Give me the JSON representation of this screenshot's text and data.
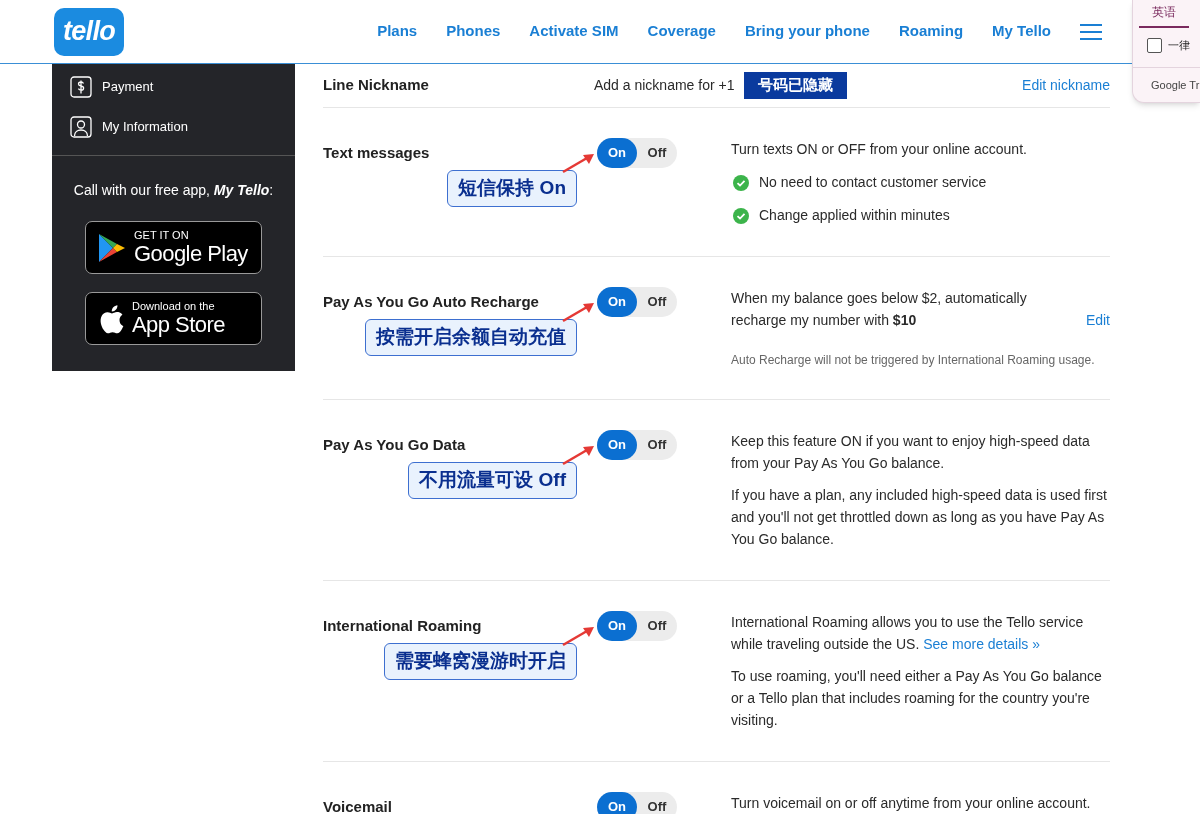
{
  "header": {
    "logo": "tello",
    "nav": [
      "Plans",
      "Phones",
      "Activate SIM",
      "Coverage",
      "Bring your phone",
      "Roaming",
      "My Tello"
    ]
  },
  "translate_popup": {
    "tab": "英语",
    "checkbox": {
      "label": "一律",
      "checked": false
    },
    "footer": "Google Tr"
  },
  "sidebar": {
    "items": [
      {
        "kind": "payment",
        "label": "Payment"
      },
      {
        "kind": "person",
        "label": "My Information"
      }
    ],
    "app_promo": "Call with our free app, **My Tello**:",
    "store_badges": [
      {
        "kind": "google",
        "small": "GET IT ON",
        "big": "Google Play"
      },
      {
        "kind": "apple",
        "small": "Download on the",
        "big": "App Store"
      }
    ]
  },
  "nickname_row": {
    "title": "Line Nickname",
    "text": "Add a nickname for +1",
    "hidden_number": "号码已隐藏",
    "link": "Edit nickname"
  },
  "settings": [
    {
      "title": "Text messages",
      "toggle": [
        {
          "label": "On",
          "selected": true
        },
        {
          "label": "Off",
          "selected": false
        }
      ],
      "callout": "短信保持 On",
      "description": [
        {
          "kind": "text",
          "text": "Turn texts ON or OFF from your online account."
        },
        {
          "kind": "check",
          "text": "No need to contact customer service"
        },
        {
          "kind": "check",
          "text": "Change applied within minutes"
        }
      ]
    },
    {
      "title": "Pay As You Go Auto Recharge",
      "toggle": [
        {
          "label": "On",
          "selected": true
        },
        {
          "label": "Off",
          "selected": false
        }
      ],
      "callout": "按需开启余额自动充值",
      "description": [
        {
          "kind": "text_with_link",
          "text": "When my balance goes below $2, automatically recharge my number with **$10**",
          "link": "Edit"
        },
        {
          "kind": "note",
          "text": "Auto Recharge will not be triggered by International Roaming usage."
        }
      ]
    },
    {
      "title": "Pay As You Go Data",
      "toggle": [
        {
          "label": "On",
          "selected": true
        },
        {
          "label": "Off",
          "selected": false
        }
      ],
      "callout": "不用流量可设 Off",
      "description": [
        {
          "kind": "text",
          "text": "Keep this feature ON if you want to enjoy high-speed data from your Pay As You Go balance."
        },
        {
          "kind": "text",
          "text": "If you have a plan, any included high-speed data is used first and you'll not get throttled down as long as you have Pay As You Go balance."
        }
      ]
    },
    {
      "title": "International Roaming",
      "toggle": [
        {
          "label": "On",
          "selected": true
        },
        {
          "label": "Off",
          "selected": false
        }
      ],
      "callout": "需要蜂窝漫游时开启",
      "description": [
        {
          "kind": "inline_link",
          "text": "International Roaming allows you to use the Tello service while traveling outside the US.",
          "link": "See more details »"
        },
        {
          "kind": "text",
          "text": "To use roaming, you'll need either a Pay As You Go balance or a Tello plan that includes roaming for the country you're visiting."
        }
      ]
    },
    {
      "title": "Voicemail",
      "toggle": [
        {
          "label": "On",
          "selected": true
        },
        {
          "label": "Off",
          "selected": false
        }
      ],
      "description": [
        {
          "kind": "text",
          "text": "Turn voicemail on or off anytime from your online account."
        }
      ]
    }
  ]
}
